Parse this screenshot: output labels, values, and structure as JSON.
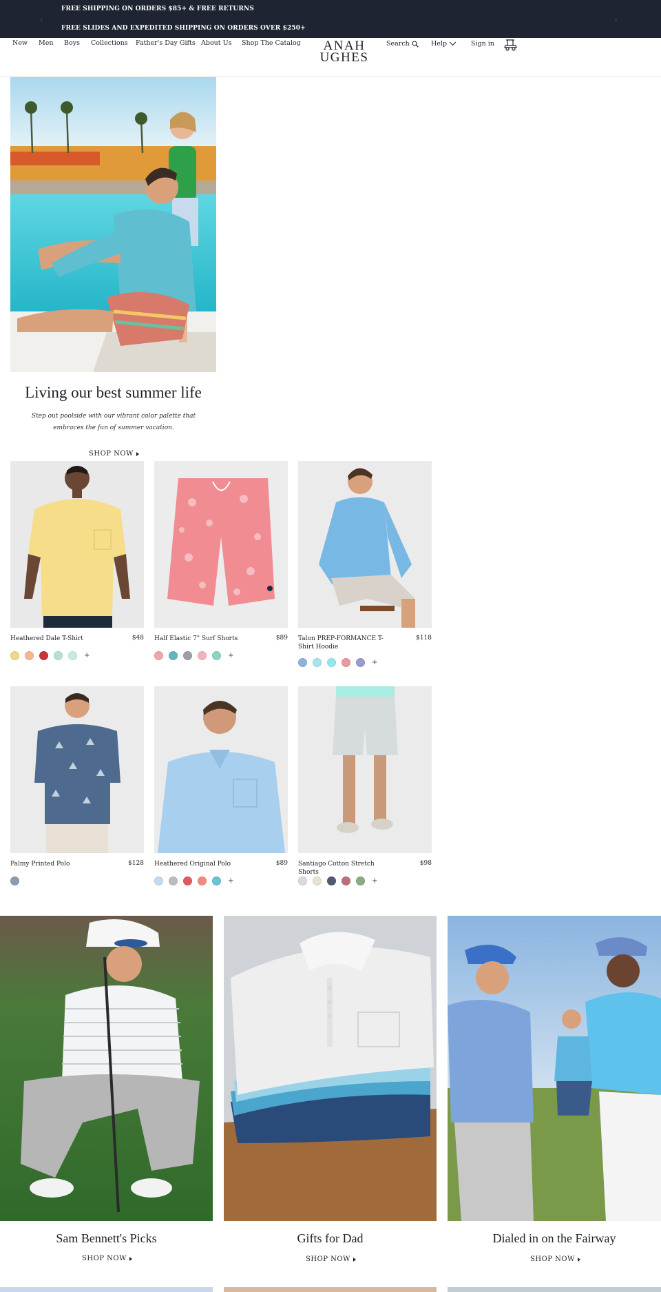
{
  "promo": {
    "line1": "FREE SHIPPING ON ORDERS $85+ & FREE RETURNS",
    "line2": "FREE SLIDES AND EXPEDITED SHIPPING ON ORDERS OVER $250+"
  },
  "nav": {
    "items": [
      "New",
      "Men",
      "Boys",
      "Collections",
      "Father's Day Gifts",
      "About Us",
      "Shop The Catalog"
    ]
  },
  "logo": {
    "line1": "ANAH",
    "line2": "UGHES"
  },
  "utility": {
    "search": "Search",
    "help": "Help",
    "sign_in": "Sign in"
  },
  "hero": {
    "title": "Living our best summer life",
    "subtitle": "Step out poolside with our vibrant color palette that embraces the fun of summer vacation.",
    "cta": "SHOP NOW"
  },
  "products": [
    {
      "name": "Heathered Dale T-Shirt",
      "price": "$48",
      "swatches": [
        "#f2d68a",
        "#f2b892",
        "#c8343a",
        "#b8e0cc",
        "#c4ece6"
      ],
      "more": "+"
    },
    {
      "name": "Half Elastic 7\" Surf Shorts",
      "price": "$89",
      "swatches": [
        "#f0a4ac",
        "#5fb8bc",
        "#9aa0a6",
        "#f2b4bc",
        "#8fd2c4"
      ],
      "more": "+"
    },
    {
      "name": "Talon PREP-FORMANCE T-Shirt Hoodie",
      "price": "$118",
      "swatches": [
        "#8fb2d8",
        "#a8e2ea",
        "#96e6ec",
        "#e89aa2",
        "#9a9ccc"
      ],
      "more": "+"
    },
    {
      "name": "Palmy Printed Polo",
      "price": "$128",
      "swatches": [
        "#8a9cb0"
      ],
      "more": ""
    },
    {
      "name": "Heathered Original Polo",
      "price": "$89",
      "swatches": [
        "#c2daf2",
        "#bcbcbc",
        "#e05a5e",
        "#f08a84",
        "#6ac2d8"
      ],
      "more": "+"
    },
    {
      "name": "Santiago Cotton Stretch Shorts",
      "price": "$98",
      "swatches": [
        "#dadada",
        "#e8e2d0",
        "#4e5a70",
        "#b8707a",
        "#8aac80"
      ],
      "more": "+"
    }
  ],
  "features": [
    {
      "title": "Sam Bennett's Picks",
      "cta": "SHOP NOW"
    },
    {
      "title": "Gifts for Dad",
      "cta": "SHOP NOW"
    },
    {
      "title": "Dialed in on the Fairway",
      "cta": "SHOP NOW"
    }
  ]
}
